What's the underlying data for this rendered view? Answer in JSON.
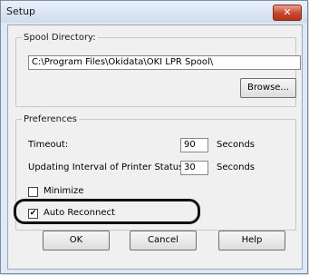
{
  "window": {
    "title": "Setup",
    "close_symbol": "✕"
  },
  "spool": {
    "group_label": "Spool Directory:",
    "path_value": "C:\\Program Files\\Okidata\\OKI LPR Spool\\",
    "browse_label": "Browse..."
  },
  "preferences": {
    "group_label": "Preferences",
    "timeout_label": "Timeout:",
    "timeout_value": "90",
    "timeout_unit": "Seconds",
    "interval_label": "Updating Interval of Printer Status:",
    "interval_value": "30",
    "interval_unit": "Seconds",
    "minimize_label": "Minimize",
    "minimize_checked": false,
    "auto_reconnect_label": "Auto Reconnect",
    "auto_reconnect_checked": true
  },
  "footer": {
    "ok_label": "OK",
    "cancel_label": "Cancel",
    "help_label": "Help"
  },
  "colors": {
    "close_button": "#c7452c",
    "frame": "#dfe9f5"
  }
}
